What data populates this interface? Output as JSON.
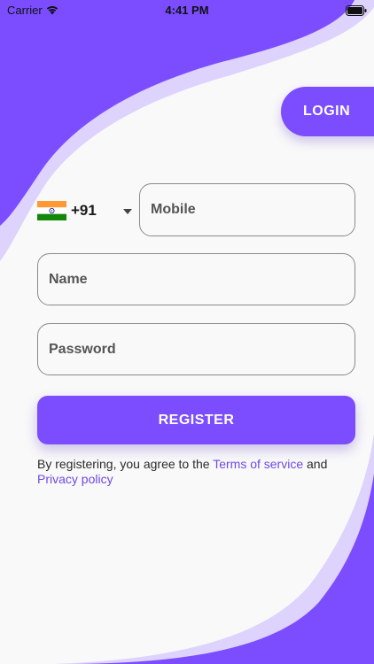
{
  "status_bar": {
    "carrier": "Carrier",
    "time": "4:41 PM",
    "icons": [
      "wifi-icon",
      "battery-icon"
    ]
  },
  "login_button": {
    "label": "LOGIN"
  },
  "phone": {
    "country_flag": "india-flag-icon",
    "dial_code": "+91",
    "dropdown_icon": "dropdown-triangle-icon",
    "mobile_placeholder": "Mobile"
  },
  "name_field": {
    "placeholder": "Name"
  },
  "password_field": {
    "placeholder": "Password"
  },
  "register_button": {
    "label": "REGISTER"
  },
  "terms": {
    "prefix": "By registering, you agree to the ",
    "terms_link": "Terms of service",
    "middle": " and",
    "privacy_link": "Privacy policy"
  },
  "colors": {
    "accent": "#7b4dff",
    "accent_light": "#ddd3fc",
    "background": "#f9f9fa",
    "link": "#6e49e6"
  }
}
